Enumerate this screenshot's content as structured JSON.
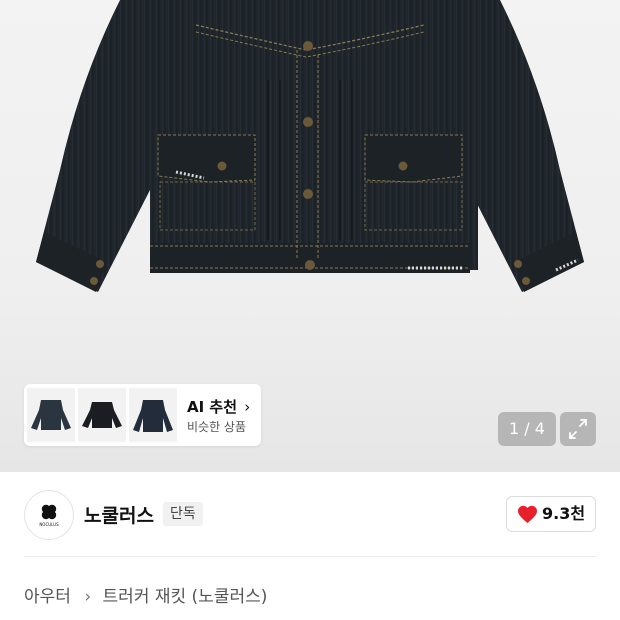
{
  "gallery": {
    "page_counter": "1 / 4",
    "expand_icon": "expand-arrows-icon"
  },
  "ai_recommend": {
    "title": "AI 추천",
    "subtitle": "비슷한 상품",
    "chevron_icon": "chevron-right-icon"
  },
  "brand": {
    "name": "노쿨러스",
    "badge": "단독",
    "logo_text": "NOCULUS"
  },
  "like": {
    "icon": "heart-icon",
    "count": "9.3천",
    "color": "#e8202a"
  },
  "breadcrumb": {
    "category": "아우터",
    "subcategory": "트러커 재킷 (노쿨러스)"
  }
}
